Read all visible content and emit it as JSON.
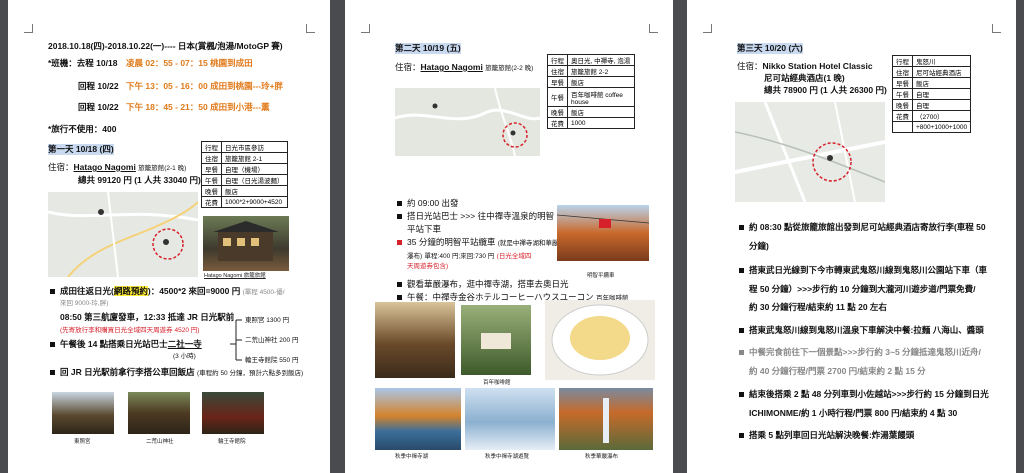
{
  "page1": {
    "title": "2018.10.18(四)-2018.10.22(一)---- 日本(賞楓/泡湯/MotoGP 賽)",
    "flight_label": "*班機：去程 10/18",
    "flight_out": "凌晨 02：55 - 07：15 桃園到成田",
    "return1_label": "回程 10/22",
    "return1_time": "下午 13：05 - 16：00 成田到桃園---玲+胖",
    "return2_label": "回程 10/22",
    "return2_time": "下午 18：45 - 21：50 成田到小港---薰",
    "travelers": "*旅行不使用：400",
    "day_heading": "第一天 10/18 (四)",
    "stay_label": "住宿：",
    "hotel": "Hatago Nagomi",
    "hotel_suffix": "旅籠旅館(2-1 晚)",
    "total": "總共 99120 円 (1 人共 33040 円)",
    "table": [
      [
        "行程",
        "日光市區參訪"
      ],
      [
        "住宿",
        "旅籠旅館 2-1"
      ],
      [
        "早餐",
        "自理（機場）"
      ],
      [
        "午餐",
        "自理（日光湯波麵）"
      ],
      [
        "晚餐",
        "飯店"
      ],
      [
        "花費",
        "1000*2+9000+4520"
      ]
    ],
    "photo_caption": "Hatago Nagomi 旅籠旅館",
    "b1_a": "成田往返日光(",
    "b1_hl": "網路預約",
    "b1_b": ")：4500*2 來回=9000 円",
    "b1_note": "(單程 4500-優/",
    "b1_note2": "來回 9000-玲,胖)",
    "b2": "08:50 第三航廈發車，12:33 抵達 JR 日光駅前",
    "b2_note": "(先寄放行李和購買日光全域四天周遊券 4520 円)",
    "b3_a": "午餐後 14 點搭乘日光站巴士",
    "b3_ul": "二社一寺",
    "b3_note": "(3 小時)",
    "fare1": "東照宮 1300 円",
    "fare2": "二荒山神社 200 円",
    "fare3": "輪王寺館院 550 円",
    "b4": "回 JR 日光駅前拿行李搭公車回飯店",
    "b4_note": "(車程約 50 分鐘，預計六點多到飯店)",
    "cap1": "東照宮",
    "cap2": "二荒山神社",
    "cap3": "輪王寺館院"
  },
  "page2": {
    "day_heading": "第二天 10/19 (五)",
    "stay_label": "住宿：",
    "hotel": "Hatago Nagomi",
    "hotel_suffix": "旅籠旅館(2-2 晚)",
    "table": [
      [
        "行程",
        "奧日光, 中禪寺, 泡湯"
      ],
      [
        "住宿",
        "旅籠旅館 2-2"
      ],
      [
        "早餐",
        "飯店"
      ],
      [
        "午餐",
        "百年咖啡館 coffee house"
      ],
      [
        "晚餐",
        "飯店"
      ],
      [
        "花費",
        "1000"
      ]
    ],
    "b1": "約 09:00 出發",
    "b2": "搭日光站巴士 >>> 往中禪寺溫泉的明智平站下車",
    "b2a": "搭日光站巴士 >>> 往中禪寺溫泉的明智",
    "b2b": "平站下車",
    "b3a": "35 分鐘的明智平站纜車",
    "b3_note": "(就是中禪寺湖和華嚴",
    "b3b": "瀑布)",
    "b3_price": "單程:400 円;來回:730 円",
    "b3_extra": "(日光全域四",
    "b3c": "天周遊券包含)",
    "cable_caption": "明智平纜車",
    "b4": "觀看華嚴瀑布，逛中禪寺湖，搭車去奧日光",
    "b5_a": "午餐：中禪寺金谷ホテルコーヒーハウスユーコン",
    "b5_note": "百年咖啡館",
    "cap_cafe": "百年咖啡館",
    "cap_lake1": "秋季中禪寺湖",
    "cap_lake2": "秋季中禪寺湖遊覽",
    "cap_fall": "秋季華嚴瀑布"
  },
  "page3": {
    "day_heading": "第三天 10/20 (六)",
    "stay_label": "住宿：",
    "hotel": "Nikko Station Hotel Classic",
    "hotel2": "尼可站經典酒店(1 晚)",
    "total": "總共 78900 円 (1 人共 26300 円)",
    "table": [
      [
        "行程",
        "鬼怒川"
      ],
      [
        "住宿",
        "尼可站經典酒店"
      ],
      [
        "早餐",
        "飯店"
      ],
      [
        "午餐",
        "自理"
      ],
      [
        "晚餐",
        "自理"
      ],
      [
        "花費",
        "（2700）"
      ],
      [
        "",
        "+800+1000+1000"
      ]
    ],
    "b1a": "約 08:30 點從旅籠旅館出發到尼可站經典酒店寄放行李(車程 50",
    "b1b": "分鐘)",
    "b2a": "搭東武日光線到下今市轉東武鬼怒川線到鬼怒川公園站下車（車",
    "b2b": "程 50 分鐘）>>>步行約 10 分鐘到大瀧河川遊步道/門票免費/",
    "b2c": "約 30 分鐘行程/結束約 11 點 20 左右",
    "b3": "搭東武鬼怒川線到鬼怒川溫泉下車解決中餐:拉麵 八海山、醬頭",
    "b4a": "中餐完食前往下一個景點>>>步行約 3~5 分鐘抵達鬼怒川近舟/",
    "b4b": "約 40 分鐘行程/門票 2700 円/結束約 2 點 15 分",
    "b5a": "結束後搭乘 2 點 48 分列車到小佐越站>>>步行約 15 分鐘到日光",
    "b5b": "ICHIMONME/約 1 小時行程/門票 800 円/結束約 4 點 30",
    "b6": "搭乘 5 點列車回日光站解決晚餐:炸湯葉饅頭"
  }
}
